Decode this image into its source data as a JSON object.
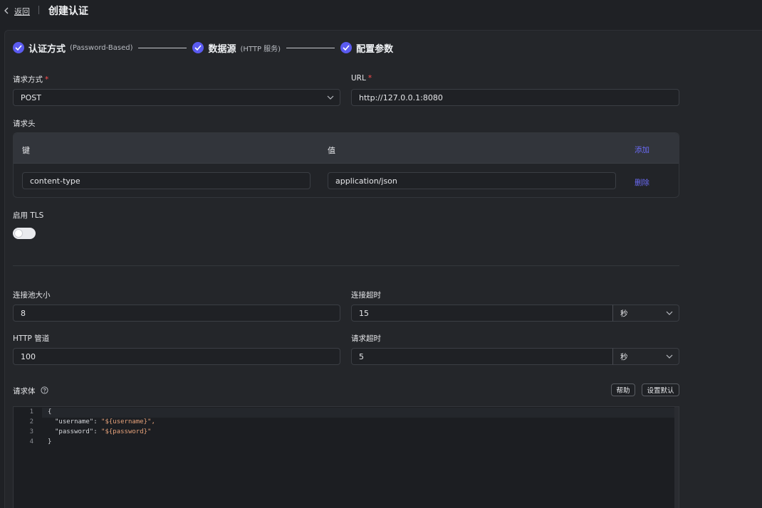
{
  "topbar": {
    "back_label": "返回",
    "title": "创建认证"
  },
  "steps": [
    {
      "label": "认证方式",
      "sub": "(Password-Based)"
    },
    {
      "label": "数据源",
      "sub": "(HTTP 服务)"
    },
    {
      "label": "配置参数",
      "sub": ""
    }
  ],
  "form": {
    "method": {
      "label": "请求方式",
      "required_mark": "*",
      "value": "POST"
    },
    "url": {
      "label": "URL",
      "required_mark": "*",
      "value": "http://127.0.0.1:8080"
    },
    "headers": {
      "label": "请求头",
      "col_key": "键",
      "col_value": "值",
      "add_label": "添加",
      "rows": [
        {
          "key": "content-type",
          "value": "application/json",
          "delete_label": "删除"
        }
      ]
    },
    "tls": {
      "label": "启用 TLS",
      "enabled": false
    },
    "pool_size": {
      "label": "连接池大小",
      "value": "8"
    },
    "connect_timeout": {
      "label": "连接超时",
      "value": "15",
      "unit": "秒"
    },
    "http_pipeline": {
      "label": "HTTP 管道",
      "value": "100"
    },
    "request_timeout": {
      "label": "请求超时",
      "value": "5",
      "unit": "秒"
    },
    "body": {
      "label": "请求体",
      "help_button": "帮助",
      "default_button": "设置默认",
      "lines": [
        {
          "n": "1",
          "text": "{"
        },
        {
          "n": "2",
          "key": "\"username\"",
          "value": "\"${username}\","
        },
        {
          "n": "3",
          "key": "\"password\"",
          "value": "\"${password}\""
        },
        {
          "n": "4",
          "text": "}"
        }
      ]
    }
  },
  "colors": {
    "accent": "#5b5bf0",
    "link": "#6b6bf7",
    "required": "#ff4d4f",
    "string": "#e6a27a"
  }
}
